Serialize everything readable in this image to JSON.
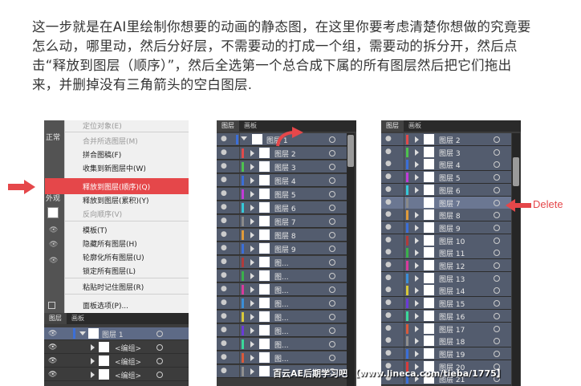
{
  "instruction": "这一步就是在AI里绘制你想要的动画的静态图，在这里你要考虑清楚你想做的究竟要怎么动，哪里动，然后分好层，不需要动的打成一个组，需要动的拆分开，然后点击“释放到图层（顺序）”，然后全选第一个总合成下属的所有图层然后把它们拖出来，并删掉没有三角箭头的空白图层.",
  "menu": {
    "items": [
      "定位对象(E)",
      "合并所选图层(M)",
      "拼合图稿(F)",
      "收集到新图层中(W)",
      "释放到图层(顺序)(Q)",
      "释放到图层(累积)(Y)",
      "反向顺序(V)",
      "模板(T)",
      "隐藏所有图层(H)",
      "轮廓化所有图层(U)",
      "锁定所有图层(L)",
      "粘贴时记住图层(R)",
      "面板选项(P)..."
    ]
  },
  "left_stubs": {
    "s1": "正常",
    "s2": "外观"
  },
  "tabs": {
    "layers": "图层",
    "artboards": "画板"
  },
  "left_layers": {
    "top": "图层 1",
    "group": "<编组>"
  },
  "mid_layers": [
    "图层 1",
    "图层 2",
    "图层 3",
    "图层 4",
    "图层 5",
    "图层 6",
    "图层 7",
    "图层 8",
    "图层 9",
    "图...",
    "图...",
    "图...",
    "图...",
    "图...",
    "图...",
    "图...",
    "图...",
    "图..."
  ],
  "right_layers": [
    "图层 2",
    "图层 3",
    "图层 4",
    "图层 5",
    "图层 6",
    "图层 7",
    "图层 8",
    "图层 9",
    "图层 10",
    "图层 11",
    "图层 12",
    "图层 13",
    "图层 14",
    "图层 15",
    "图层 16",
    "图层 17",
    "图层 18",
    "图层 19",
    "图层 20",
    "图层 21"
  ],
  "delete_label": "Delete",
  "watermark": "百云AE后期学习吧 【www.lineca.com/tieba/1775】",
  "colors": {
    "accent_red": "#e5474a",
    "selected_row": "#5d6a86"
  }
}
